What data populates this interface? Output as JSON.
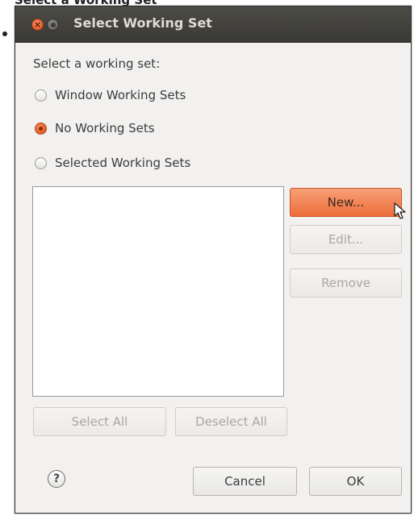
{
  "caption": "Select a Working Set",
  "window": {
    "title": "Select Working Set"
  },
  "dialog": {
    "section_label": "Select a working set:",
    "radios": [
      {
        "label": "Window Working Sets",
        "checked": false
      },
      {
        "label": "No Working Sets",
        "checked": true
      },
      {
        "label": "Selected Working Sets",
        "checked": false
      }
    ],
    "buttons": {
      "new": "New...",
      "edit": "Edit...",
      "remove": "Remove",
      "select_all": "Select All",
      "deselect_all": "Deselect All",
      "cancel": "Cancel",
      "ok": "OK"
    },
    "help_glyph": "?"
  },
  "colors": {
    "accent": "#ec6d3a",
    "titlebar": "#3c3b37",
    "dialog_bg": "#f2f1f0"
  },
  "icons": {
    "close": "close-icon",
    "minimize": "minimize-icon",
    "help": "help-icon",
    "cursor": "mouse-pointer-icon"
  }
}
